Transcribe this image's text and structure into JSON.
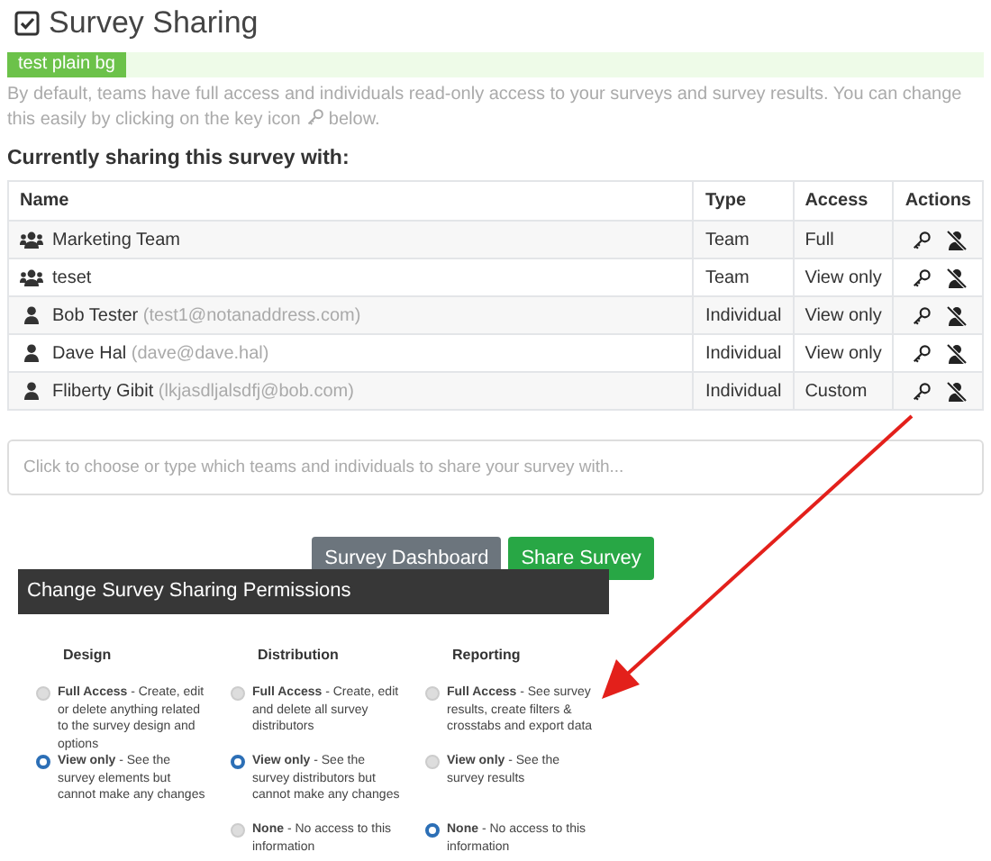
{
  "page_title": "Survey Sharing",
  "banner": {
    "label": "test plain bg"
  },
  "description": "By default, teams have full access and individuals read-only access to your surveys and survey results. You can change this easily by clicking on the key icon",
  "description_end": "below.",
  "section_heading": "Currently sharing this survey with:",
  "table": {
    "columns": [
      "Name",
      "Type",
      "Access",
      "Actions"
    ],
    "rows": [
      {
        "kind": "team",
        "name": "Marketing Team",
        "type": "Team",
        "access": "Full"
      },
      {
        "kind": "team",
        "name": "teset",
        "type": "Team",
        "access": "View only"
      },
      {
        "kind": "individual",
        "name": "Bob Tester",
        "email": "(test1@notanaddress.com)",
        "type": "Individual",
        "access": "View only"
      },
      {
        "kind": "individual",
        "name": "Dave Hal",
        "email": "(dave@dave.hal)",
        "type": "Individual",
        "access": "View only"
      },
      {
        "kind": "individual",
        "name": "Fliberty Gibit",
        "email": "(lkjasdljalsdfj@bob.com)",
        "type": "Individual",
        "access": "Custom"
      }
    ]
  },
  "share_field": {
    "placeholder": "Click to choose or type which teams and individuals to share your survey with..."
  },
  "buttons": [
    {
      "kind": "secondary",
      "label": "Survey Dashboard"
    },
    {
      "kind": "primary",
      "label": "Share Survey"
    }
  ],
  "permissions": {
    "title": "Change Survey Sharing Permissions",
    "groups": [
      {
        "heading": "Design",
        "options": [
          {
            "text": "**Full Access** - Create, edit or delete anything related to the survey design and options",
            "selected": false
          },
          {
            "text": "**View only** - See the survey elements but cannot make any changes",
            "selected": true
          }
        ]
      },
      {
        "heading": "Distribution",
        "options": [
          {
            "text": "**Full Access** - Create, edit and delete all survey distributors",
            "selected": false
          },
          {
            "text": "**View only** - See the survey distributors but cannot make any changes",
            "selected": true
          },
          {
            "text": "**None** - No access to this information",
            "selected": false
          }
        ]
      },
      {
        "heading": "Reporting",
        "options": [
          {
            "text": "**Full Access** - See survey results, create filters & crosstabs and export data",
            "selected": false
          },
          {
            "text": "**View only** - See the survey results",
            "selected": false
          },
          {
            "text": "**None** - No access to this information",
            "selected": true
          }
        ]
      }
    ]
  }
}
